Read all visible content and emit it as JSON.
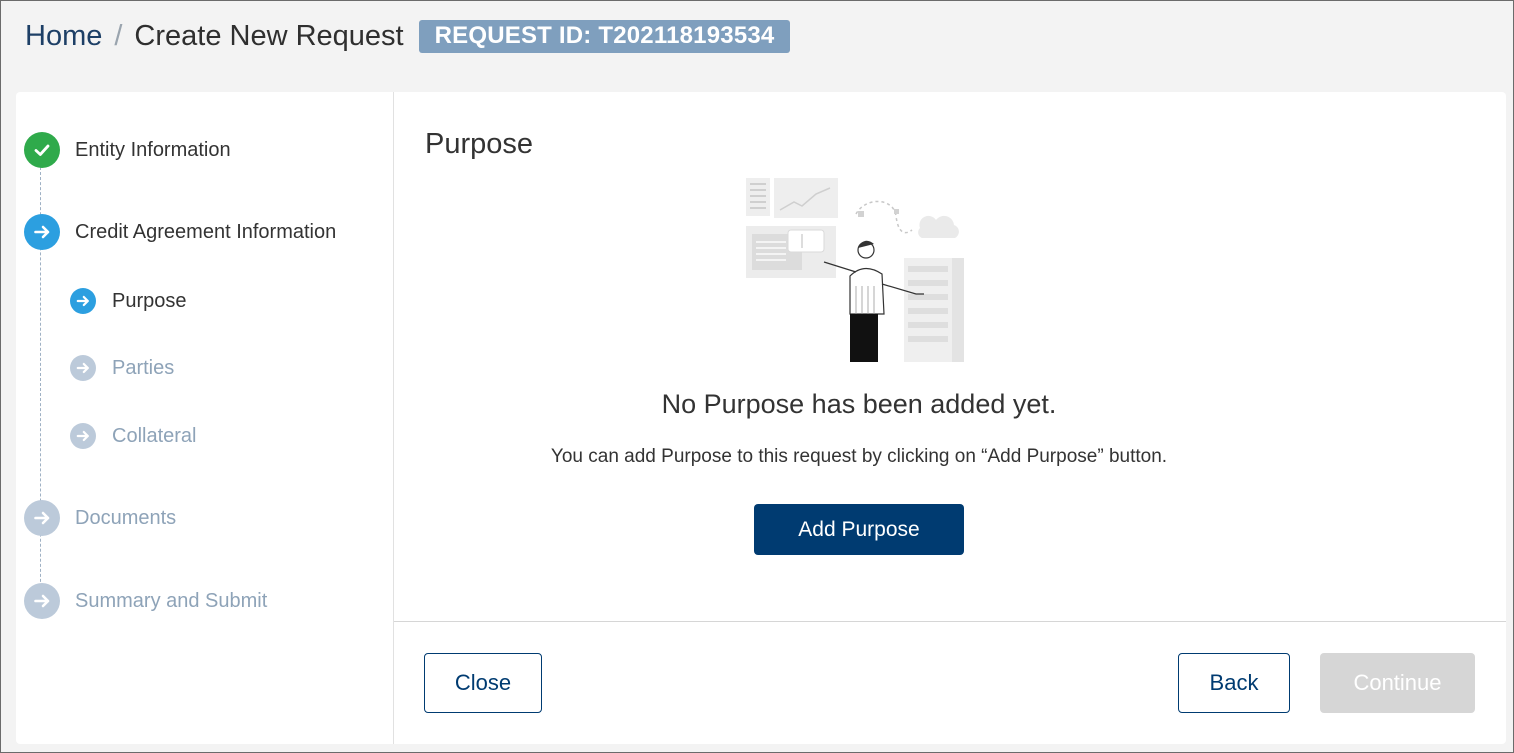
{
  "header": {
    "breadcrumb_home": "Home",
    "breadcrumb_separator": "/",
    "breadcrumb_current": "Create New Request",
    "request_id": "REQUEST ID: T202118193534"
  },
  "stepper": {
    "steps": [
      {
        "label": "Entity Information",
        "status": "completed",
        "icon": "check-icon"
      },
      {
        "label": "Credit Agreement Information",
        "status": "active",
        "icon": "arrow-right-icon"
      },
      {
        "label": "Documents",
        "status": "pending",
        "icon": "arrow-right-icon"
      },
      {
        "label": "Summary and Submit",
        "status": "pending",
        "icon": "arrow-right-icon"
      }
    ],
    "substeps": [
      {
        "label": "Purpose",
        "status": "active"
      },
      {
        "label": "Parties",
        "status": "pending"
      },
      {
        "label": "Collateral",
        "status": "pending"
      }
    ]
  },
  "main": {
    "section_title": "Purpose",
    "empty_title": "No Purpose has been added yet.",
    "empty_description": "You can add Purpose to this request by clicking on “Add Purpose” button.",
    "add_button": "Add Purpose"
  },
  "footer": {
    "close_label": "Close",
    "back_label": "Back",
    "continue_label": "Continue"
  },
  "colors": {
    "primary": "#003b71",
    "completed": "#2faa4b",
    "active": "#2c9fe0",
    "pending": "#bccada",
    "badge": "#7f9fbe"
  }
}
